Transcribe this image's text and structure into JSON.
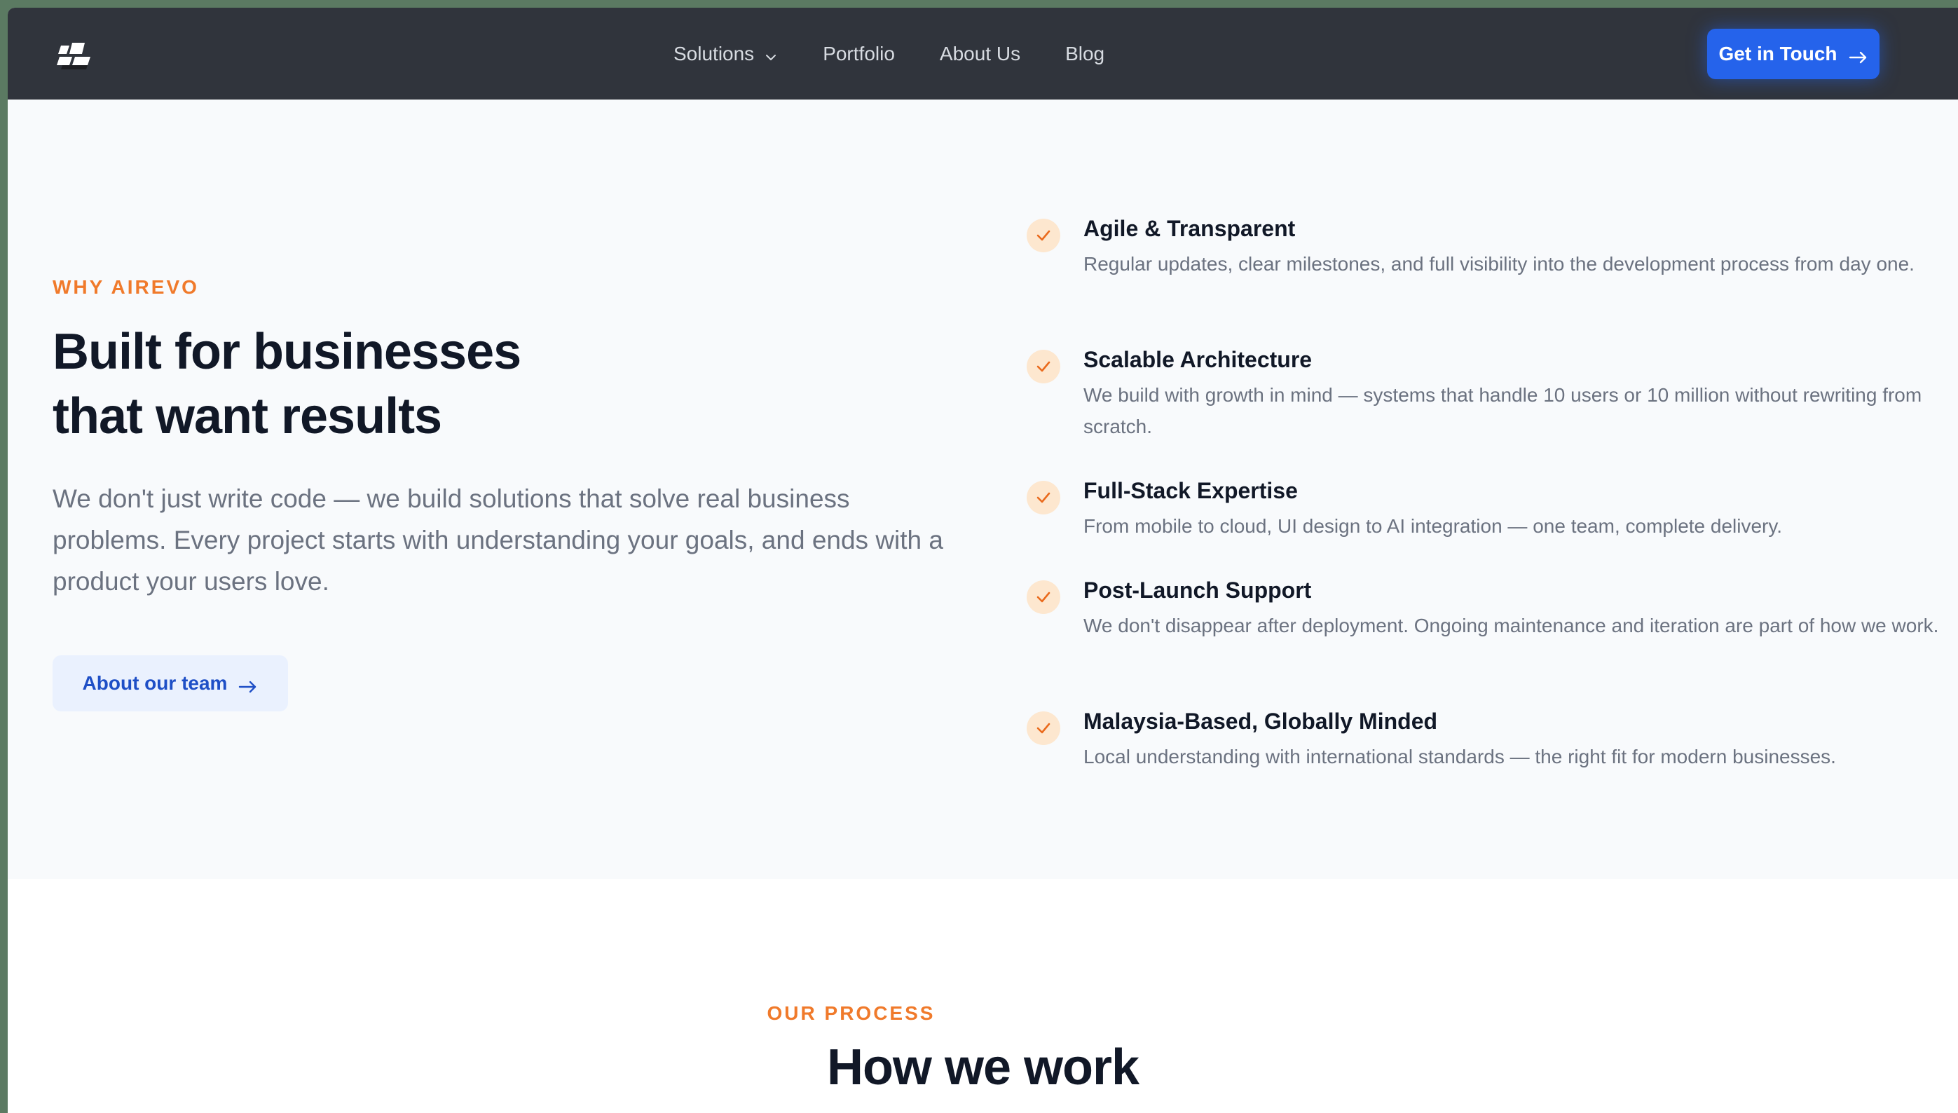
{
  "nav": {
    "logo_icon": "airevo-logo-icon",
    "links": [
      {
        "label": "Solutions",
        "has_dropdown": true
      },
      {
        "label": "Portfolio",
        "has_dropdown": false
      },
      {
        "label": "About Us",
        "has_dropdown": false
      },
      {
        "label": "Blog",
        "has_dropdown": false
      }
    ],
    "cta_label": "Get in Touch"
  },
  "why": {
    "eyebrow": "WHY AIREVO",
    "headline_line1": "Built for businesses",
    "headline_line2": "that want results",
    "lead": "We don't just write code — we build solutions that solve real business problems. Every project starts with understanding your goals, and ends with a product your users love.",
    "button_label": "About our team",
    "features": [
      {
        "title": "Agile & Transparent",
        "description": "Regular updates, clear milestones, and full visibility into the development process from day one."
      },
      {
        "title": "Scalable Architecture",
        "description": "We build with growth in mind — systems that handle 10 users or 10 million without rewriting from scratch."
      },
      {
        "title": "Full-Stack Expertise",
        "description": "From mobile to cloud, UI design to AI integration — one team, complete delivery."
      },
      {
        "title": "Post-Launch Support",
        "description": "We don't disappear after deployment. Ongoing maintenance and iteration are part of how we work."
      },
      {
        "title": "Malaysia-Based, Globally Minded",
        "description": "Local understanding with international standards — the right fit for modern businesses."
      }
    ]
  },
  "process": {
    "eyebrow": "OUR PROCESS",
    "title": "How we work"
  },
  "colors": {
    "navbar_bg": "#30343c",
    "accent_blue": "#2563eb",
    "accent_orange": "#f07a2b",
    "section_bg": "#f8fafc"
  }
}
